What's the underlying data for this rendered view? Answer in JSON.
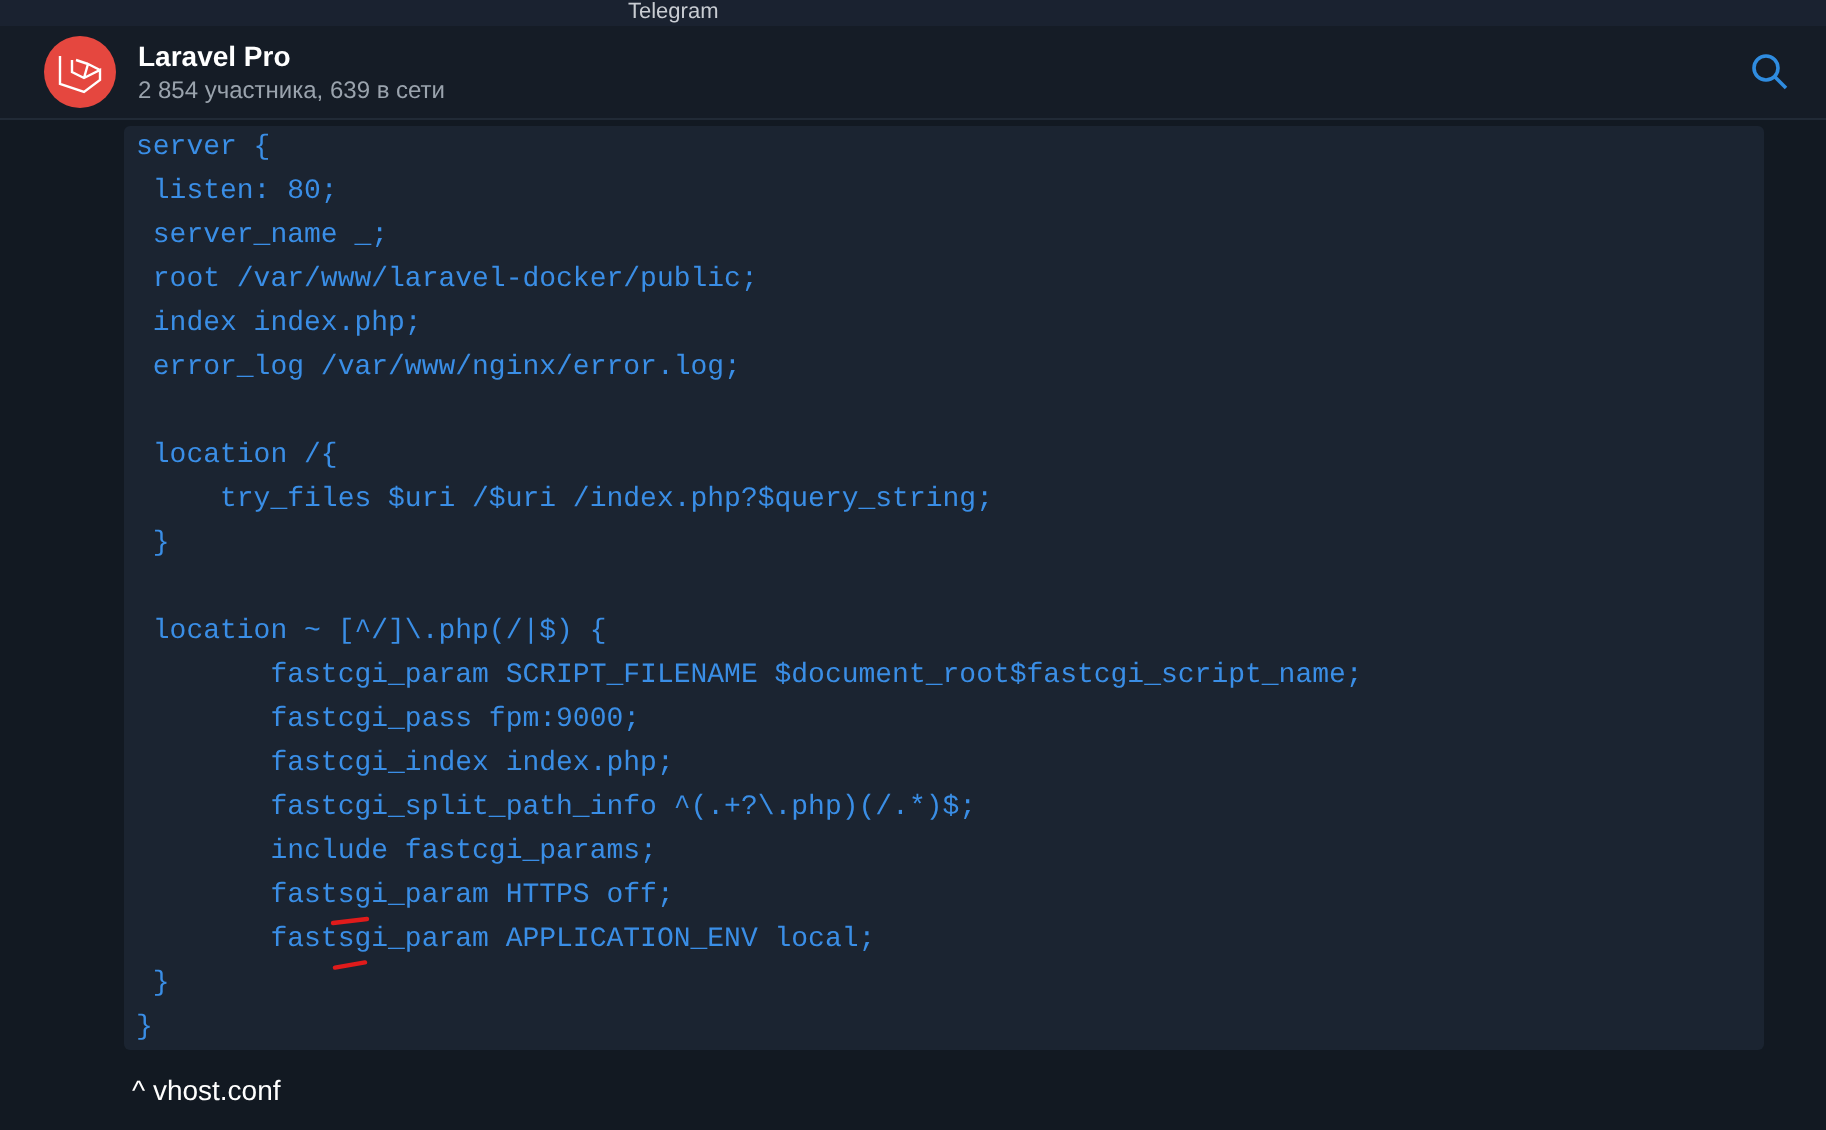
{
  "window": {
    "title": "Telegram"
  },
  "chat": {
    "title": "Laravel Pro",
    "subtitle": "2 854 участника, 639 в сети"
  },
  "message": {
    "code_blocks": [
      [
        "server {",
        " listen: 80;",
        " server_name _;",
        " root /var/www/laravel-docker/public;",
        " index index.php;",
        " error_log /var/www/nginx/error.log;"
      ],
      [
        " location /{",
        "     try_files $uri /$uri /index.php?$query_string;",
        " }"
      ],
      [
        " location ~ [^/]\\.php(/|$) {",
        "        fastcgi_param SCRIPT_FILENAME $document_root$fastcgi_script_name;",
        "        fastcgi_pass fpm:9000;",
        "        fastcgi_index index.php;",
        "        fastcgi_split_path_info ^(.+?\\.php)(/.*)$;",
        "        include fastcgi_params;",
        "        fastsgi_param HTTPS off;",
        "        fastsgi_param APPLICATION_ENV local;",
        " }",
        "}"
      ]
    ],
    "caption": "^ vhost.conf"
  }
}
